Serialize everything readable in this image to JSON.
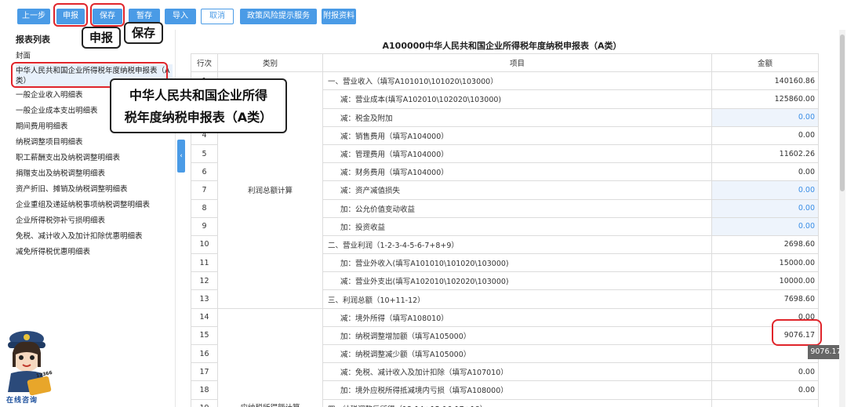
{
  "toolbar": {
    "buttons": [
      "上一步",
      "申报",
      "保存",
      "暂存",
      "导入",
      "取消",
      "政策风险提示服务",
      "附报资料"
    ]
  },
  "callouts": {
    "declare": "申报",
    "save": "保存",
    "form_name_line1": "中华人民共和国企业所得",
    "form_name_line2": "税年度纳税申报表（A类）"
  },
  "sidebar": {
    "title": "报表列表",
    "items": [
      "封面",
      "中华人民共和国企业所得税年度纳税申报表（A类）",
      "一般企业收入明细表",
      "一般企业成本支出明细表",
      "期间费用明细表",
      "纳税调整项目明细表",
      "职工薪酬支出及纳税调整明细表",
      "捐赠支出及纳税调整明细表",
      "资产折旧、摊销及纳税调整明细表",
      "企业重组及递延纳税事项纳税调整明细表",
      "企业所得税弥补亏损明细表",
      "免税、减计收入及加计扣除优惠明细表",
      "减免所得税优惠明细表"
    ],
    "active_index": 1
  },
  "form": {
    "title": "A100000中华人民共和国企业所得税年度纳税申报表（A类）",
    "columns": [
      "行次",
      "类别",
      "项目",
      "金额"
    ],
    "category_profit": "利润总额计算",
    "category_taxable": "应纳税所得额计算",
    "rows": [
      {
        "no": "1",
        "item": "一、营业收入（填写A101010\\101020\\103000）",
        "amount": "140160.86",
        "editable": false,
        "sub": false
      },
      {
        "no": "2",
        "item": "减：营业成本(填写A102010\\102020\\103000)",
        "amount": "125860.00",
        "editable": false,
        "sub": true
      },
      {
        "no": "3",
        "item": "减：税金及附加",
        "amount": "0.00",
        "editable": true,
        "sub": true
      },
      {
        "no": "4",
        "item": "减：销售费用（填写A104000）",
        "amount": "0.00",
        "editable": false,
        "sub": true
      },
      {
        "no": "5",
        "item": "减：管理费用（填写A104000）",
        "amount": "11602.26",
        "editable": false,
        "sub": true
      },
      {
        "no": "6",
        "item": "减：财务费用（填写A104000）",
        "amount": "0.00",
        "editable": false,
        "sub": true
      },
      {
        "no": "7",
        "item": "减：资产减值损失",
        "amount": "0.00",
        "editable": true,
        "sub": true
      },
      {
        "no": "8",
        "item": "加：公允价值变动收益",
        "amount": "0.00",
        "editable": true,
        "sub": true
      },
      {
        "no": "9",
        "item": "加：投资收益",
        "amount": "0.00",
        "editable": true,
        "sub": true
      },
      {
        "no": "10",
        "item": "二、营业利润（1-2-3-4-5-6-7+8+9）",
        "amount": "2698.60",
        "editable": false,
        "sub": false
      },
      {
        "no": "11",
        "item": "加：营业外收入(填写A101010\\101020\\103000)",
        "amount": "15000.00",
        "editable": false,
        "sub": true
      },
      {
        "no": "12",
        "item": "减：营业外支出(填写A102010\\102020\\103000)",
        "amount": "10000.00",
        "editable": false,
        "sub": true
      },
      {
        "no": "13",
        "item": "三、利润总额（10+11-12）",
        "amount": "7698.60",
        "editable": false,
        "sub": false
      },
      {
        "no": "14",
        "item": "减：境外所得（填写A108010）",
        "amount": "0.00",
        "editable": false,
        "sub": true
      },
      {
        "no": "15",
        "item": "加：纳税调整增加额（填写A105000）",
        "amount": "9076.17",
        "editable": false,
        "sub": true
      },
      {
        "no": "16",
        "item": "减：纳税调整减少额（填写A105000）",
        "amount": "0.",
        "editable": false,
        "sub": true
      },
      {
        "no": "17",
        "item": "减：免税、减计收入及加计扣除（填写A107010）",
        "amount": "0.00",
        "editable": false,
        "sub": true
      },
      {
        "no": "18",
        "item": "加：境外应税所得抵减境内亏损（填写A108000）",
        "amount": "0.00",
        "editable": false,
        "sub": true
      },
      {
        "no": "19",
        "item": "四、纳税调整后所得（13-14+15-16-17+18）",
        "amount": "",
        "editable": false,
        "sub": false
      }
    ]
  },
  "tooltip": "9076.17",
  "mascot": {
    "badge": "12366",
    "caption": "在线咨询"
  },
  "colors": {
    "accent": "#4a9be6",
    "highlight": "#e0252b",
    "editable_bg": "#eef4fc"
  }
}
